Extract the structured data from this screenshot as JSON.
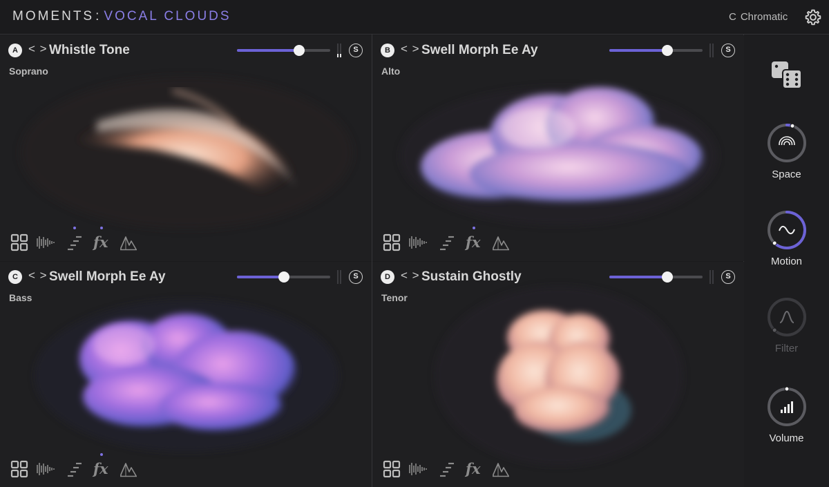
{
  "header": {
    "brand_primary": "MOMENTS",
    "brand_separator": ":",
    "brand_secondary": "VOCAL CLOUDS",
    "key_root": "C",
    "key_scale": "Chromatic"
  },
  "panels": [
    {
      "letter": "A",
      "title": "Whistle Tone",
      "voice": "Soprano",
      "level": 0.67,
      "solo_label": "S",
      "tool_dots": [
        "sequencer",
        "fx"
      ]
    },
    {
      "letter": "B",
      "title": "Swell Morph Ee Ay",
      "voice": "Alto",
      "level": 0.62,
      "solo_label": "S",
      "tool_dots": [
        "fx"
      ]
    },
    {
      "letter": "C",
      "title": "Swell Morph Ee Ay",
      "voice": "Bass",
      "level": 0.5,
      "solo_label": "S",
      "tool_dots": [
        "fx"
      ]
    },
    {
      "letter": "D",
      "title": "Sustain Ghostly",
      "voice": "Tenor",
      "level": 0.62,
      "solo_label": "S",
      "tool_dots": []
    }
  ],
  "tools": {
    "fx_label": "fx",
    "icons": [
      "grid-icon",
      "waveform-icon",
      "sequencer-icon",
      "fx-icon",
      "envelope-icon"
    ]
  },
  "sidebar": {
    "randomize_icon": "dice-icon",
    "knobs": [
      {
        "label": "Space",
        "value": 0.05,
        "enabled": true,
        "icon": "rings-icon"
      },
      {
        "label": "Motion",
        "value": 0.62,
        "enabled": true,
        "icon": "sine-wave-icon"
      },
      {
        "label": "Filter",
        "value": 0.62,
        "enabled": false,
        "icon": "bell-curve-icon"
      },
      {
        "label": "Volume",
        "value": 0.0,
        "enabled": true,
        "icon": "level-bars-icon"
      }
    ]
  },
  "colors": {
    "accent": "#6c62d6",
    "brand_accent": "#8a7ee6",
    "background": "#1b1b1d",
    "panel": "#1f1f21"
  }
}
